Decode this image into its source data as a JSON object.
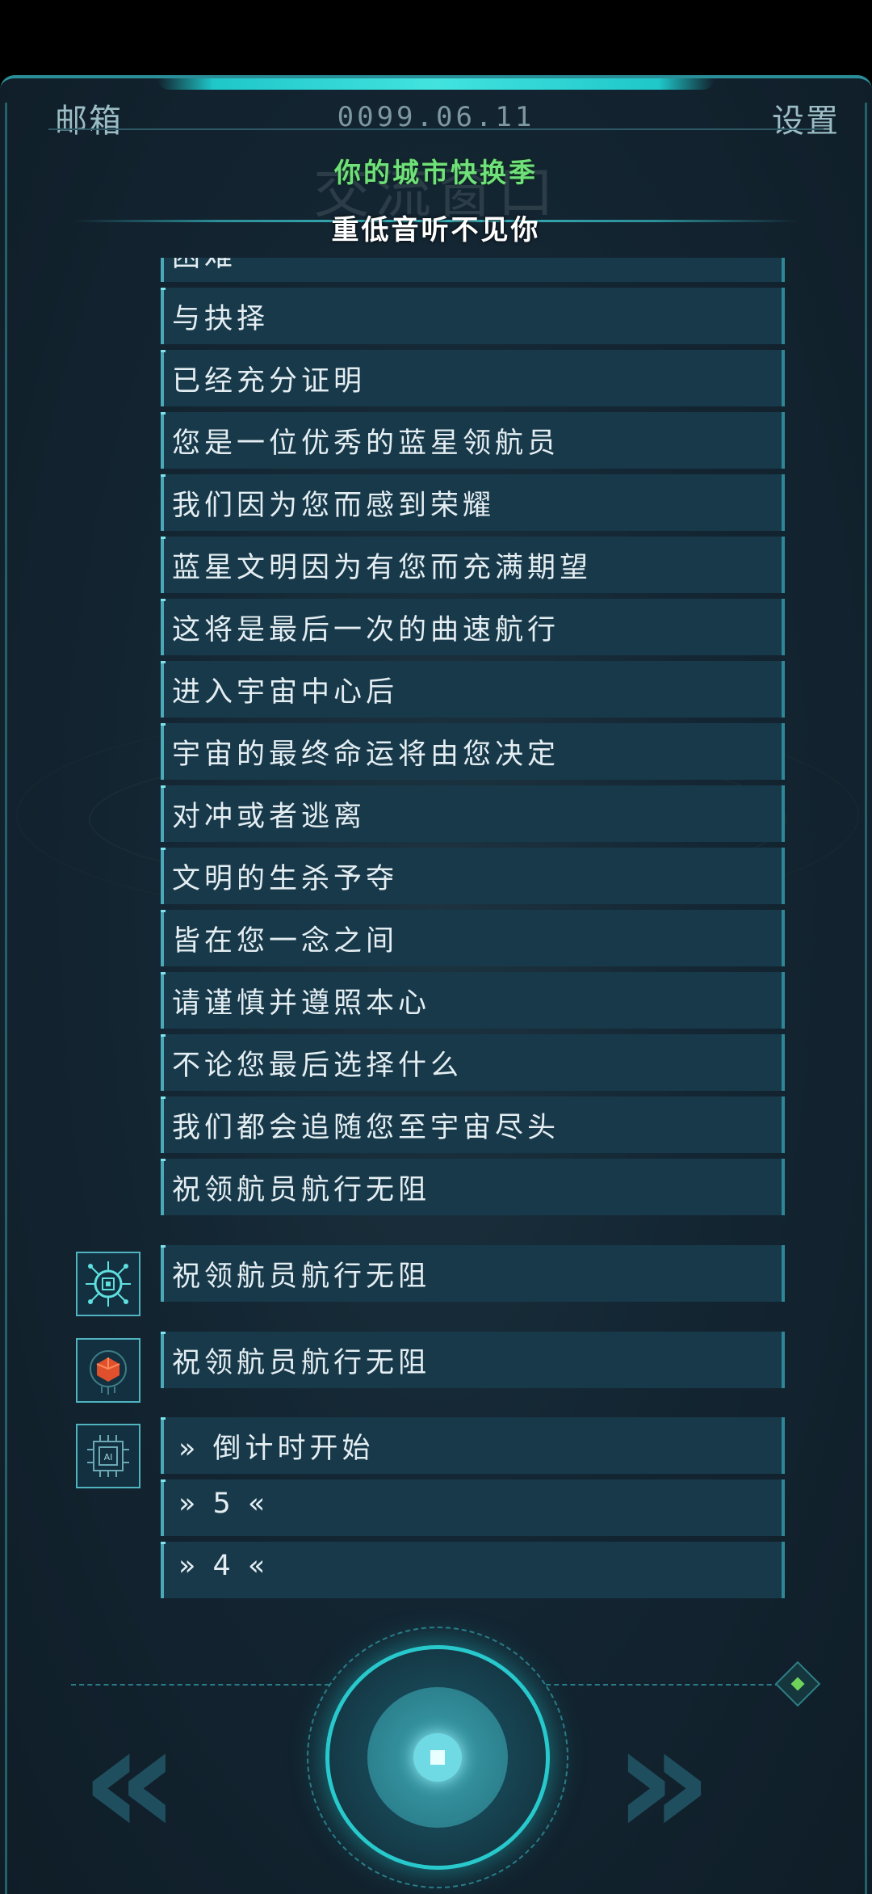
{
  "header": {
    "mailbox_label": "邮箱",
    "date": "0099.06.11",
    "settings_label": "设置",
    "ghost_title": "交流窗口"
  },
  "lyrics": {
    "line1": "你的城市快换季",
    "line2": "重低音听不见你"
  },
  "messages": [
    "困难",
    "与抉择",
    "已经充分证明",
    "您是一位优秀的蓝星领航员",
    "我们因为您而感到荣耀",
    "蓝星文明因为有您而充满期望",
    "这将是最后一次的曲速航行",
    "进入宇宙中心后",
    "宇宙的最终命运将由您决定",
    "对冲或者逃离",
    "文明的生杀予夺",
    "皆在您一念之间",
    "请谨慎并遵照本心",
    "不论您最后选择什么",
    "我们都会追随您至宇宙尽头",
    "祝领航员航行无阻"
  ],
  "replies": [
    {
      "avatar": "robot-chip-avatar",
      "text": "祝领航员航行无阻"
    },
    {
      "avatar": "red-cube-avatar",
      "text": "祝领航员航行无阻"
    },
    {
      "avatar": "ai-chip-avatar",
      "text": "» 倒计时开始"
    }
  ],
  "countdown": [
    "» 5 «",
    "» 4 «"
  ],
  "colors": {
    "accent": "#28c9cc",
    "row_bg": "#18394a",
    "lyric_green": "#6fe07a"
  }
}
